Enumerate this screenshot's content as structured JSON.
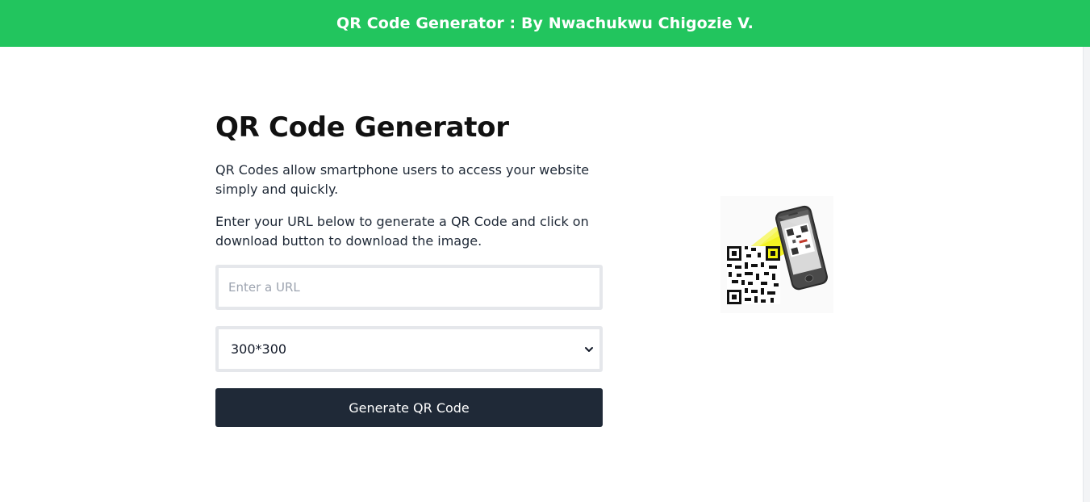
{
  "header": {
    "title": "QR Code Generator : By Nwachukwu Chigozie V."
  },
  "main": {
    "heading": "QR Code Generator",
    "paragraph1": "QR Codes allow smartphone users to access your website simply and quickly.",
    "paragraph2": "Enter your URL below to generate a QR Code and click on download button to download the image.",
    "url_input": {
      "value": "",
      "placeholder": "Enter a URL"
    },
    "size_select": {
      "selected": "300*300"
    },
    "generate_button_label": "Generate QR Code"
  },
  "illustration": {
    "icon": "phone-scanning-qr-icon"
  },
  "colors": {
    "header_bg": "#22c55e",
    "button_bg": "#1f2937",
    "beam": "#f2f20a"
  }
}
